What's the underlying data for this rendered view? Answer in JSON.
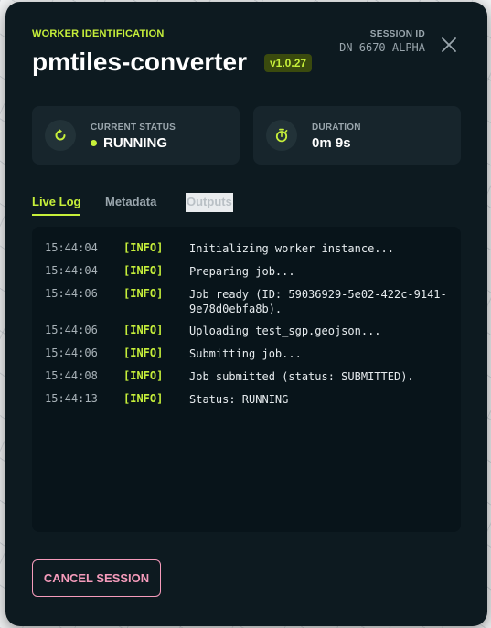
{
  "header": {
    "eyebrow": "WORKER IDENTIFICATION",
    "title": "pmtiles-converter",
    "version": "v1.0.27",
    "session_label": "SESSION ID",
    "session_id": "DN-6670-ALPHA",
    "close_icon": "close-icon"
  },
  "status_card": {
    "label": "CURRENT STATUS",
    "value": "RUNNING",
    "icon": "refresh-icon"
  },
  "duration_card": {
    "label": "DURATION",
    "value": "0m 9s",
    "icon": "stopwatch-icon"
  },
  "tabs": [
    {
      "label": "Live Log",
      "active": true
    },
    {
      "label": "Metadata",
      "active": false
    },
    {
      "label": "Outputs",
      "active": false
    }
  ],
  "log": [
    {
      "time": "15:44:04",
      "level": "[INFO]",
      "message": "Initializing worker instance..."
    },
    {
      "time": "15:44:04",
      "level": "[INFO]",
      "message": "Preparing job..."
    },
    {
      "time": "15:44:06",
      "level": "[INFO]",
      "message": "Job ready (ID: 59036929-5e02-422c-9141-9e78d0ebfa8b)."
    },
    {
      "time": "15:44:06",
      "level": "[INFO]",
      "message": "Uploading test_sgp.geojson..."
    },
    {
      "time": "15:44:06",
      "level": "[INFO]",
      "message": "Submitting job..."
    },
    {
      "time": "15:44:08",
      "level": "[INFO]",
      "message": "Job submitted (status: SUBMITTED)."
    },
    {
      "time": "15:44:13",
      "level": "[INFO]",
      "message": "Status: RUNNING"
    }
  ],
  "actions": {
    "cancel_label": "CANCEL SESSION"
  },
  "colors": {
    "accent": "#c6ef3a",
    "panel_bg": "#0d1a20",
    "danger": "#f59bbb"
  }
}
